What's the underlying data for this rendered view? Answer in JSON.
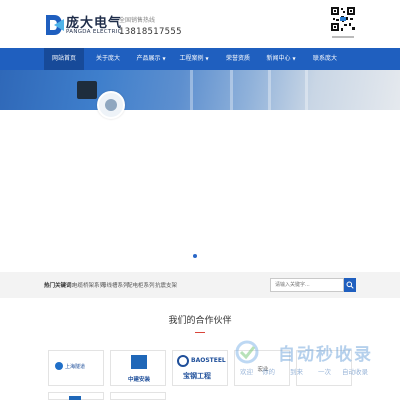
{
  "header": {
    "logo_cn": "庞大电气",
    "logo_en": "PANGDA ELECTRIC",
    "hotline_label": "全国销售热线",
    "hotline_number": "13818517555"
  },
  "nav": {
    "items": [
      {
        "label": "网站首页",
        "caret": ""
      },
      {
        "label": "关于庞大",
        "caret": ""
      },
      {
        "label": "产品展示",
        "caret": "▼"
      },
      {
        "label": "工程案例",
        "caret": "▼"
      },
      {
        "label": "荣誉资质",
        "caret": ""
      },
      {
        "label": "新闻中心",
        "caret": "▼"
      },
      {
        "label": "联系庞大",
        "caret": ""
      }
    ],
    "active_index": 0
  },
  "search": {
    "hot_label": "热门关键词：",
    "keywords": [
      "电缆桥架系列",
      "母线槽系列",
      "配电柜系列",
      "抗震支架"
    ],
    "placeholder": "请输入关键字..."
  },
  "partners": {
    "title": "我们的合作伙伴",
    "items": [
      {
        "name": "上海隧道"
      },
      {
        "name": "中建安装"
      },
      {
        "name": "BAOSTEEL",
        "sub": "宝钢工程"
      },
      {
        "name": "宏业"
      },
      {
        "name": ""
      }
    ]
  },
  "watermark": {
    "brand": "自动秒收录",
    "slogan": [
      "欢迎",
      "你的",
      "到来",
      "一次",
      "自动收录"
    ]
  },
  "colors": {
    "brand_blue": "#1f5fbf",
    "accent_red": "#d9453a"
  }
}
